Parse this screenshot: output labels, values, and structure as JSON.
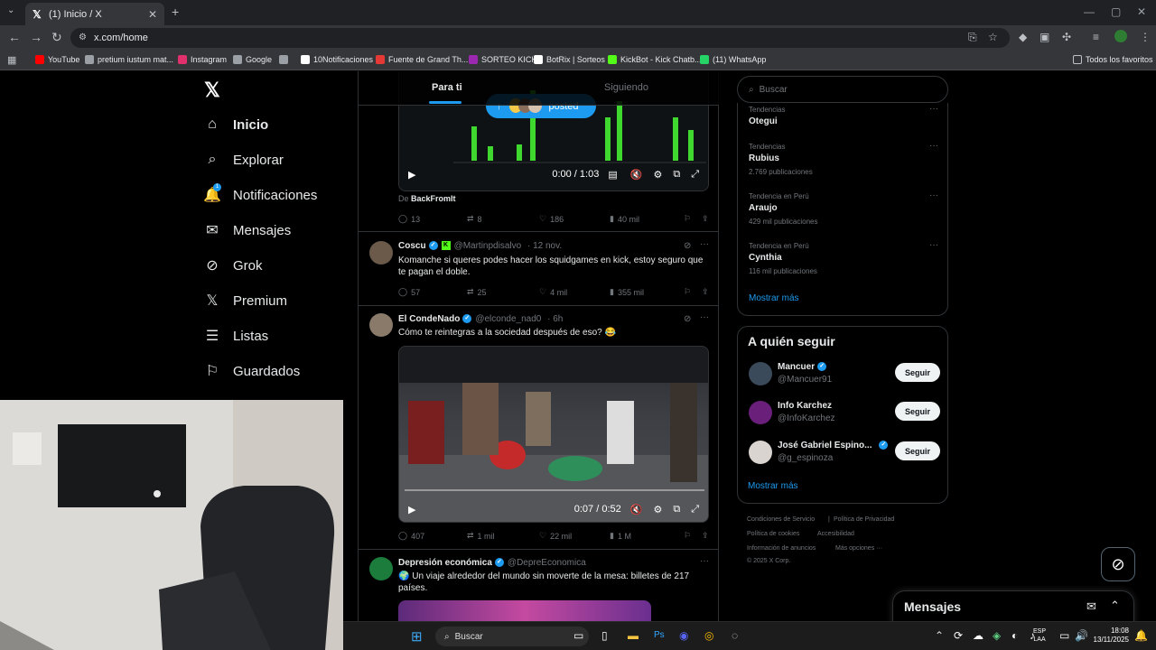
{
  "browser": {
    "tab_title": "(1) Inicio / X",
    "url": "x.com/home",
    "bookmarks": [
      {
        "label": "YouTube",
        "color": "#ff0000"
      },
      {
        "label": "pretium iustum mat...",
        "color": "#9aa0a6"
      },
      {
        "label": "Instagram",
        "color": "#e1306c"
      },
      {
        "label": "Google",
        "color": "#9aa0a6"
      },
      {
        "label": "",
        "color": "#9aa0a6"
      },
      {
        "label": "10Notificaciones",
        "color": "#ffffff"
      },
      {
        "label": "Fuente de Grand Th...",
        "color": "#e53935"
      },
      {
        "label": "SORTEO KICK",
        "color": "#9c27b0"
      },
      {
        "label": "BotRix | Sorteos",
        "color": "#ffffff"
      },
      {
        "label": "KickBot - Kick Chatb...",
        "color": "#53fc18"
      },
      {
        "label": "(11) WhatsApp",
        "color": "#25d366"
      }
    ],
    "all_bookmarks": "Todos los favoritos"
  },
  "sidebar": {
    "items": [
      {
        "label": "Inicio",
        "icon": "home-icon",
        "glyph": "⌂"
      },
      {
        "label": "Explorar",
        "icon": "search-icon",
        "glyph": "⌕"
      },
      {
        "label": "Notificaciones",
        "icon": "bell-icon",
        "glyph": "🔔",
        "badge": "1"
      },
      {
        "label": "Mensajes",
        "icon": "mail-icon",
        "glyph": "✉"
      },
      {
        "label": "Grok",
        "icon": "grok-icon",
        "glyph": "⊘"
      },
      {
        "label": "Premium",
        "icon": "x-icon",
        "glyph": "𝕏"
      },
      {
        "label": "Listas",
        "icon": "list-icon",
        "glyph": "☰"
      },
      {
        "label": "Guardados",
        "icon": "bookmark-icon",
        "glyph": "⚐"
      }
    ]
  },
  "feed": {
    "tabs": [
      "Para ti",
      "Siguiendo"
    ],
    "top_video": {
      "time": "0:00 / 1:03",
      "posted_label": "posted",
      "source_prefix": "De",
      "source": "BackFromIt",
      "actions": {
        "replies": "13",
        "reposts": "8",
        "likes": "186",
        "views": "40 mil"
      }
    },
    "tweets": [
      {
        "name": "Coscu",
        "handle": "@Martinpdisalvo",
        "time": "· 12 nov.",
        "text": "Komanche si queres podes hacer los squidgames en kick, estoy seguro que te pagan el doble.",
        "actions": {
          "replies": "57",
          "reposts": "25",
          "likes": "4 mil",
          "views": "355 mil"
        }
      },
      {
        "name": "El CondeNado",
        "handle": "@elconde_nad0",
        "time": "· 6h",
        "text": "Cómo te reintegras a la sociedad después de eso? 😂",
        "video_time": "0:07 / 0:52",
        "actions": {
          "replies": "407",
          "reposts": "1 mil",
          "likes": "22 mil",
          "views": "1 M"
        }
      },
      {
        "name": "Depresión económica",
        "handle": "@DepreEconomica",
        "text": "🌍 Un viaje alrededor del mundo sin moverte de la mesa: billetes de 217 países."
      }
    ]
  },
  "right": {
    "search_placeholder": "Buscar",
    "trends": [
      {
        "context": "Tendencias",
        "topic": "Otegui",
        "count": ""
      },
      {
        "context": "Tendencias",
        "topic": "Rubius",
        "count": "2.769 publicaciones"
      },
      {
        "context": "Tendencia en Perú",
        "topic": "Araujo",
        "count": "429 mil publicaciones"
      },
      {
        "context": "Tendencia en Perú",
        "topic": "Cynthia",
        "count": "116 mil publicaciones"
      }
    ],
    "show_more": "Mostrar más",
    "who_to_follow_title": "A quién seguir",
    "follow": [
      {
        "name": "Mancuer",
        "handle": "@Mancuer91",
        "button": "Seguir"
      },
      {
        "name": "Info Karchez",
        "handle": "@InfoKarchez",
        "button": "Seguir"
      },
      {
        "name": "José Gabriel Espino...",
        "handle": "@g_espinoza",
        "button": "Seguir"
      }
    ],
    "show_more2": "Mostrar más",
    "footer": {
      "l1a": "Condiciones de Servicio",
      "l1b": "Política de Privacidad",
      "l2a": "Política de cookies",
      "l2b": "Accesibilidad",
      "l3a": "Información de anuncios",
      "l3b": "Más opciones ···",
      "copy": "© 2025 X Corp."
    },
    "messages": "Mensajes"
  },
  "taskbar": {
    "search": "Buscar",
    "lang": "ESP",
    "lang2": "LAA",
    "time": "18:08",
    "date": "13/11/2025"
  }
}
